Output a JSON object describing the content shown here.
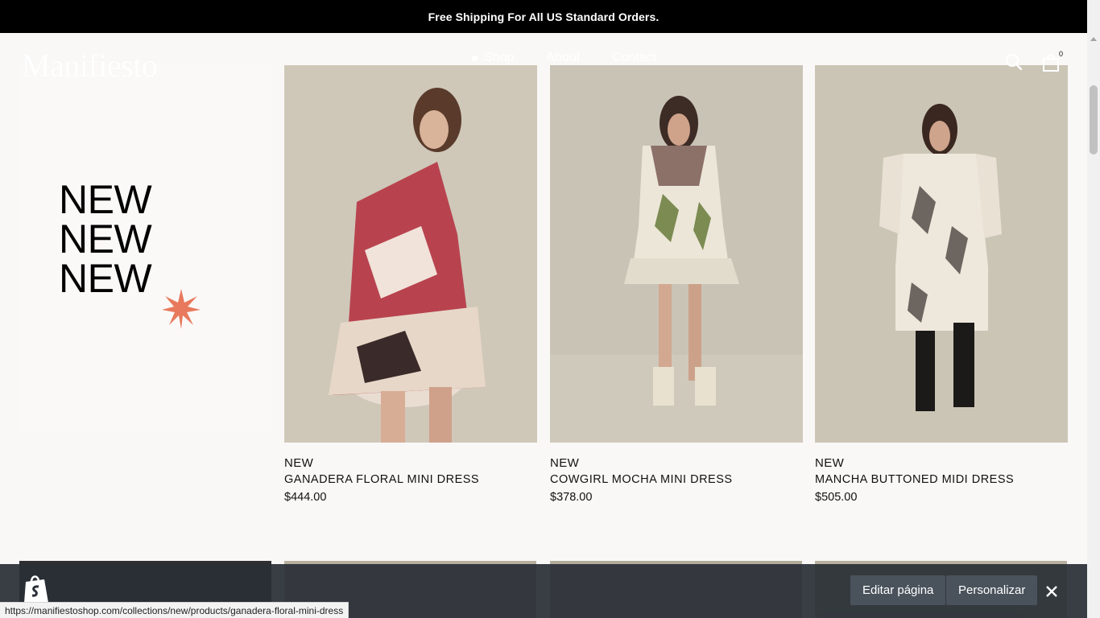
{
  "announcement": "Free Shipping For All US Standard Orders.",
  "header": {
    "logo": "Manifiesto",
    "nav": [
      "Shop",
      "About",
      "Contact"
    ],
    "cart_count": "0",
    "icons": [
      "search-icon",
      "cart-icon"
    ]
  },
  "promo": {
    "lines": [
      "NEW",
      "NEW",
      "NEW"
    ],
    "star_color": "#e8795c"
  },
  "products": [
    {
      "badge": "NEW",
      "name": "GANADERA FLORAL MINI DRESS",
      "price": "$444.00"
    },
    {
      "badge": "NEW",
      "name": "COWGIRL MOCHA MINI DRESS",
      "price": "$378.00"
    },
    {
      "badge": "NEW",
      "name": "MANCHA BUTTONED MIDI DRESS",
      "price": "$505.00"
    }
  ],
  "admin": {
    "edit_label": "Editar página",
    "customize_label": "Personalizar",
    "icons": [
      "shopify-bag-icon",
      "close-icon"
    ]
  },
  "status_url": "https://manifiestoshop.com/collections/new/products/ganadera-floral-mini-dress"
}
